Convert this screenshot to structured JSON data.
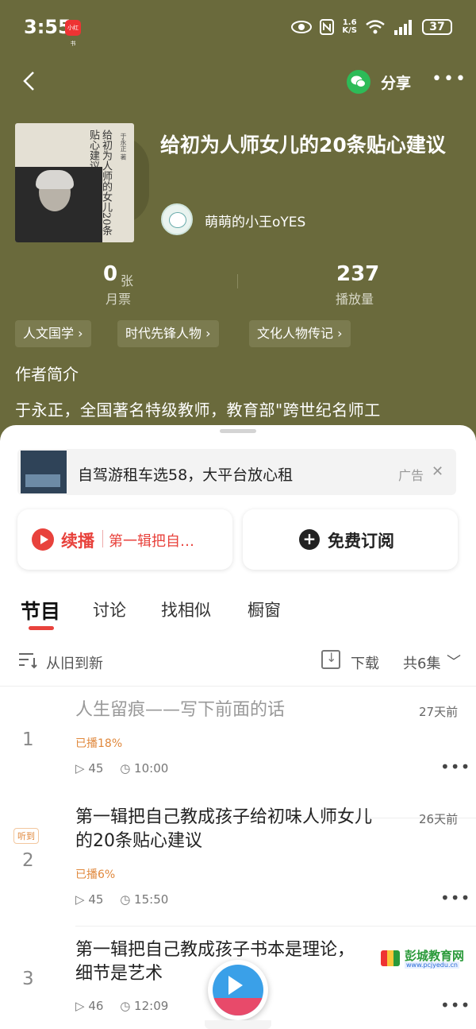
{
  "status_bar": {
    "time": "3:55",
    "app_badge": "小红书",
    "net_speed_top": "1.6",
    "net_speed_bottom": "K/S",
    "battery": "37"
  },
  "nav": {
    "share_label": "分享",
    "more": "•••"
  },
  "book": {
    "title": "给初为人师女儿的20条贴心建议",
    "cover_text": "给初为人师的女儿20条贴心建议",
    "cover_author": "于永正 著",
    "author": "萌萌的小王oYES"
  },
  "stats": {
    "tickets_value": "0",
    "tickets_unit": "张",
    "tickets_label": "月票",
    "plays_value": "237",
    "plays_label": "播放量"
  },
  "tags": [
    "人文国学 ›",
    "时代先锋人物 ›",
    "文化人物传记 ›"
  ],
  "intro": {
    "heading": "作者简介",
    "text": "于永正，全国著名特级教师，教育部\"跨世纪名师工"
  },
  "ad": {
    "text": "自驾游租车选58，大平台放心租",
    "tag": "广告",
    "close": "✕"
  },
  "actions": {
    "resume_label": "续播",
    "resume_episode": "第一辑把自…",
    "subscribe_label": "免费订阅",
    "plus": "+"
  },
  "tabs": [
    "节目",
    "讨论",
    "找相似",
    "橱窗"
  ],
  "list_bar": {
    "sort_label": "从旧到新",
    "download_label": "下载",
    "count_label": "共6集",
    "chevron": "﹀"
  },
  "episodes": [
    {
      "num": "1",
      "title": "人生留痕——写下前面的话",
      "date": "27天前",
      "progress": "已播18%",
      "plays": "45",
      "duration": "10:00",
      "badge": ""
    },
    {
      "num": "2",
      "title": "第一辑把自己教成孩子给初味人师女儿的20条贴心建议",
      "date": "26天前",
      "progress": "已播6%",
      "plays": "45",
      "duration": "15:50",
      "badge": "听到"
    },
    {
      "num": "3",
      "title": "第一辑把自己教成孩子书本是理论，细节是艺术",
      "date": "",
      "progress": "",
      "plays": "46",
      "duration": "12:09",
      "badge": ""
    }
  ],
  "watermark": {
    "text": "彭城教育网",
    "url": "www.pcjyedu.cn"
  },
  "colors": {
    "header_bg": "#6a6a3c",
    "accent_red": "#e8423c",
    "progress_orange": "#e0883c",
    "wechat_green": "#2dbb58"
  }
}
